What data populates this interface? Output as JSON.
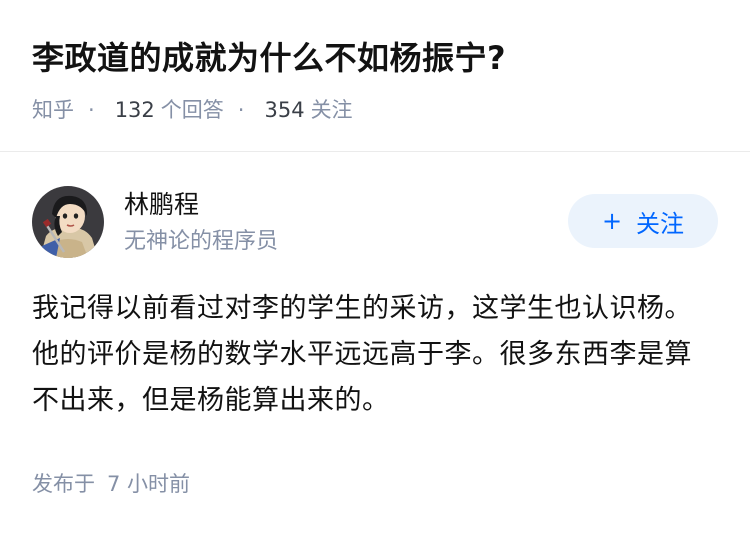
{
  "question": {
    "title": "李政道的成就为什么不如杨振宁?",
    "source": "知乎",
    "answer_count": "132",
    "answer_label": "个回答",
    "follower_count": "354",
    "follower_label": "关注"
  },
  "author": {
    "name": "林鹏程",
    "bio": "无神论的程序员",
    "avatar_icon": "avatar-cartoon-warrior",
    "follow_label": "关注",
    "follow_icon": "plus-icon"
  },
  "answer": {
    "text": "我记得以前看过对李的学生的采访，这学生也认识杨。他的评价是杨的数学水平远远高于李。很多东西李是算不出来，但是杨能算出来的。",
    "posted_label": "发布于",
    "posted_time": "7 小时前"
  },
  "colors": {
    "brand_blue": "#0066ff",
    "follow_bg": "#ebf3fc",
    "meta_gray": "#8590a6"
  }
}
